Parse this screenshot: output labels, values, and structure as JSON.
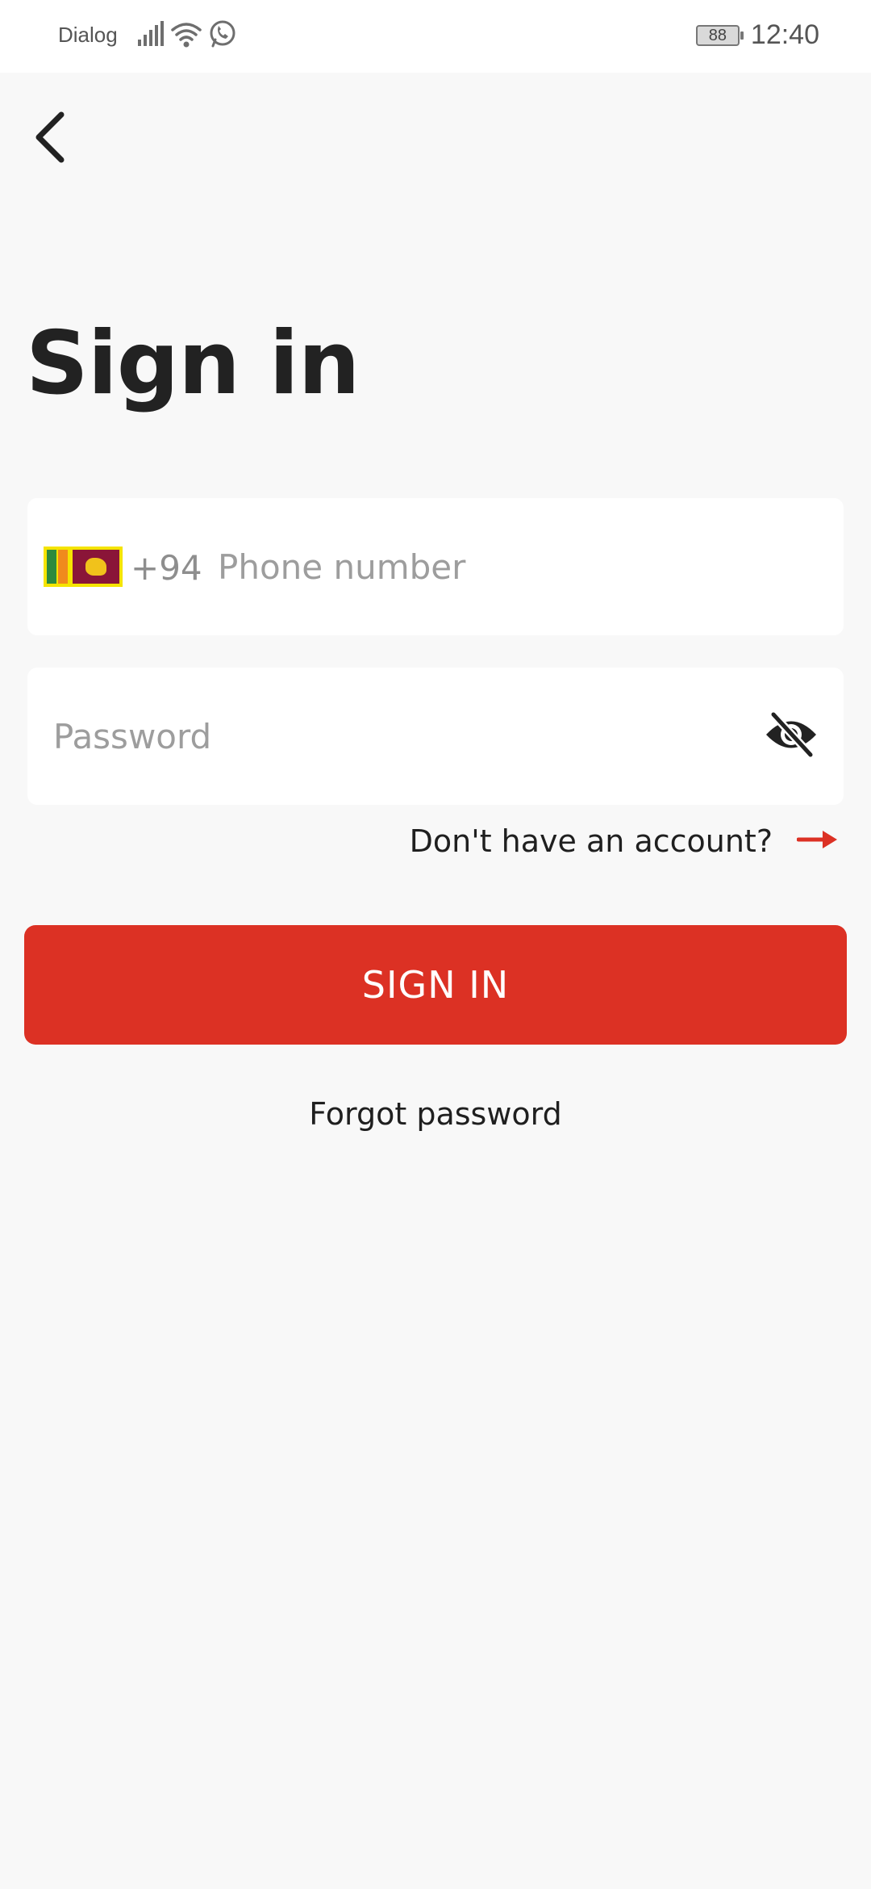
{
  "status_bar": {
    "carrier": "Dialog",
    "battery_level": "88",
    "time": "12:40",
    "icons": [
      "signal-icon",
      "wifi-icon",
      "whatsapp-icon"
    ]
  },
  "nav": {
    "back_icon": "chevron-left-icon"
  },
  "page": {
    "title": "Sign in"
  },
  "phone_field": {
    "flag_icon": "sri-lanka-flag-icon",
    "country_code": "+94",
    "placeholder": "Phone number",
    "value": ""
  },
  "password_field": {
    "placeholder": "Password",
    "value": "",
    "visibility_icon": "eye-off-icon"
  },
  "account_link": {
    "label": "Don't have an account?",
    "arrow_icon": "arrow-right-icon"
  },
  "sign_in_button": {
    "label": "SIGN IN"
  },
  "forgot_password": {
    "label": "Forgot password"
  },
  "colors": {
    "accent": "#dc3124",
    "background": "#f8f8f8",
    "field_background": "#ffffff",
    "placeholder": "#9d9d9d",
    "text": "#1f1f1f"
  }
}
